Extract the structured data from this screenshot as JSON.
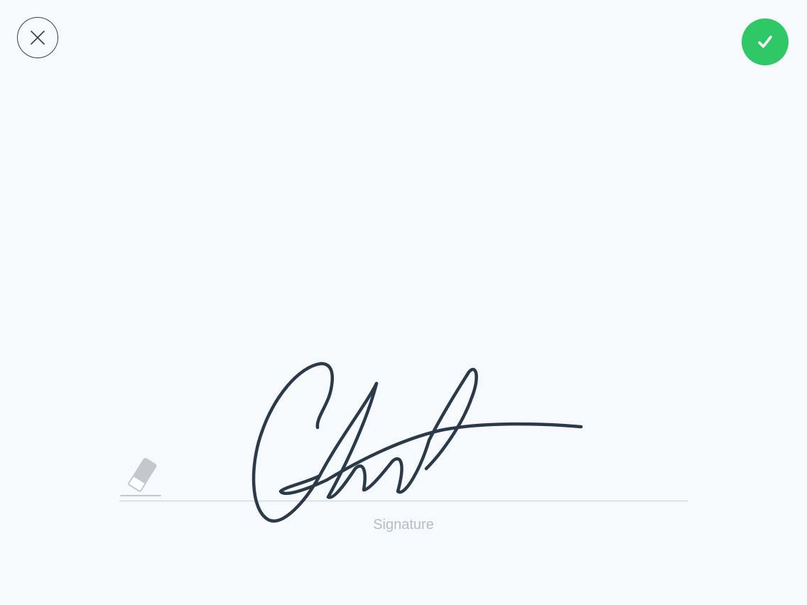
{
  "signature_pad": {
    "label": "Signature",
    "close_icon": "close-icon",
    "confirm_icon": "checkmark-icon",
    "eraser_icon": "eraser-icon"
  },
  "colors": {
    "background": "#f7fafc",
    "confirm": "#2ec866",
    "ink": "#2b3a48",
    "baseline": "#c9ced3",
    "label": "#b5bcc3"
  }
}
